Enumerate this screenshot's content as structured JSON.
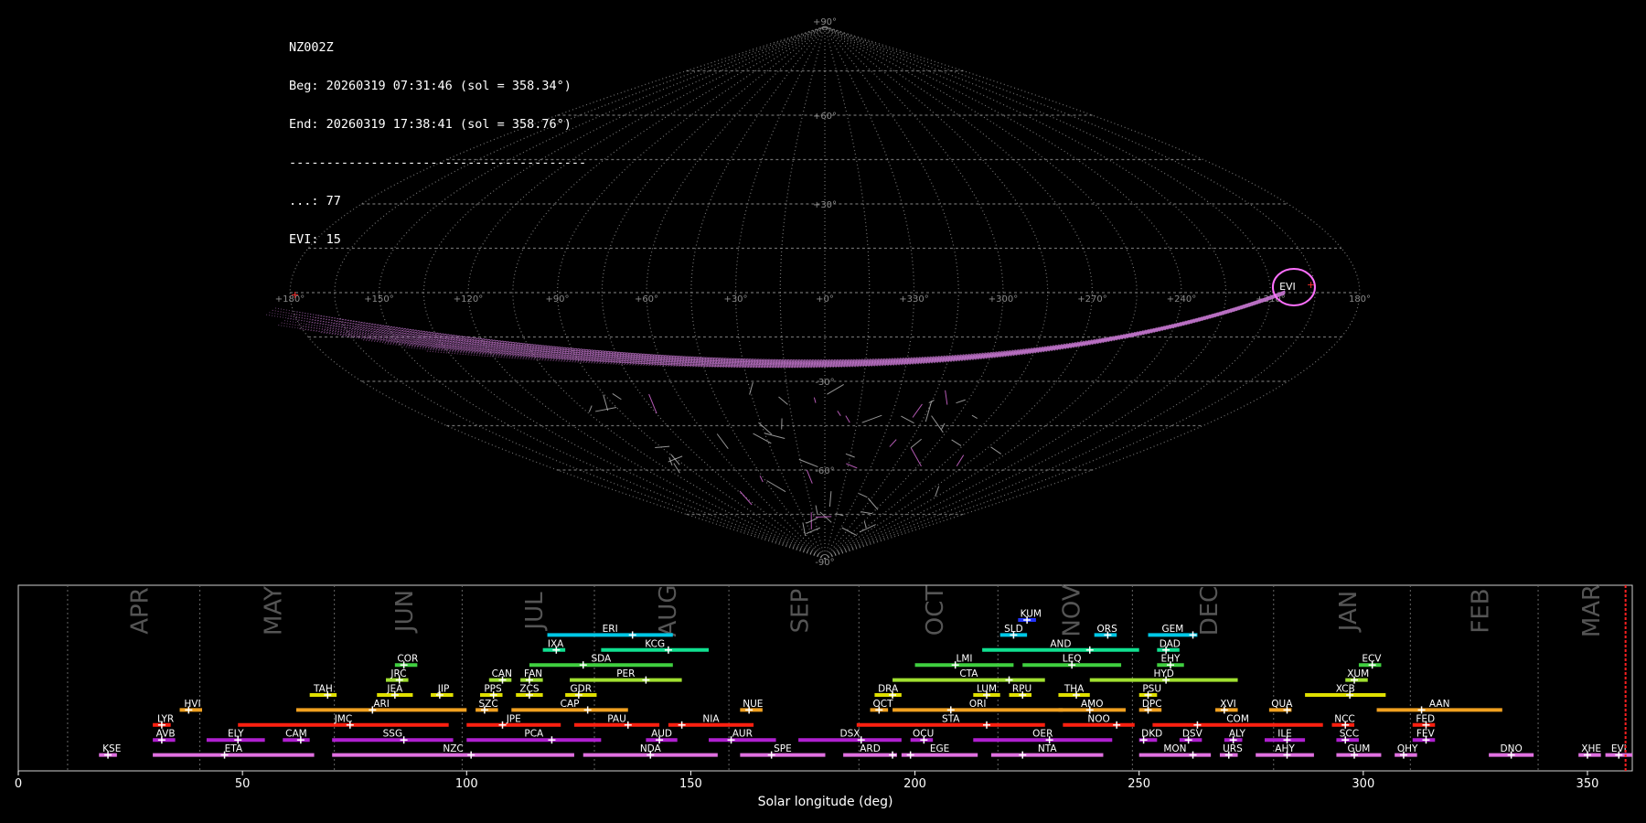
{
  "info": {
    "station": "NZ002Z",
    "begin": "Beg: 20260319 07:31:46 (sol = 358.34°)",
    "end": "End: 20260319 17:38:41 (sol = 358.76°)",
    "separator": "----------------------------------------",
    "sporadic": "...: 77",
    "shower": "EVI: 15"
  },
  "chart_data": [
    {
      "type": "scatter",
      "projection": "sinusoidal-equal-area",
      "lon_ticks": [
        "+180°",
        "+150°",
        "+120°",
        "+90°",
        "+60°",
        "+30°",
        "+0°",
        "+330°",
        "+300°",
        "+270°",
        "+240°",
        "+210°",
        "180°"
      ],
      "lat_ticks": [
        "+90°",
        "+60°",
        "+30°",
        "-30°",
        "-60°",
        "-90°"
      ],
      "radiant": {
        "label": "EVI",
        "ra": 185,
        "dec": 4
      }
    },
    {
      "type": "bar",
      "xlabel": "Solar longitude (deg)",
      "xlim": [
        0,
        360
      ],
      "xticks": [
        0,
        50,
        100,
        150,
        200,
        250,
        300,
        350
      ],
      "current_sol": 358.5,
      "months": [
        {
          "name": "APR",
          "start": 11
        },
        {
          "name": "MAY",
          "start": 40.5
        },
        {
          "name": "JUN",
          "start": 70.5
        },
        {
          "name": "JUL",
          "start": 99
        },
        {
          "name": "AUG",
          "start": 128.5
        },
        {
          "name": "SEP",
          "start": 158.5
        },
        {
          "name": "OCT",
          "start": 187.5
        },
        {
          "name": "NOV",
          "start": 218.5
        },
        {
          "name": "DEC",
          "start": 248.5
        },
        {
          "name": "JAN",
          "start": 280
        },
        {
          "name": "FEB",
          "start": 310.5
        },
        {
          "name": "MAR",
          "start": 339
        }
      ],
      "showers": [
        {
          "code": "KUM",
          "start": 223,
          "end": 227,
          "peak": 225,
          "row": 10,
          "color": "#2233ff"
        },
        {
          "code": "ERI",
          "start": 118,
          "end": 146,
          "peak": 137,
          "row": 9,
          "color": "#00c8e6"
        },
        {
          "code": "SLD",
          "start": 219,
          "end": 225,
          "peak": 222,
          "row": 9,
          "color": "#00c8e6"
        },
        {
          "code": "ORS",
          "start": 240,
          "end": 245,
          "peak": 243,
          "row": 9,
          "color": "#00c8e6"
        },
        {
          "code": "GEM",
          "start": 252,
          "end": 263,
          "peak": 262,
          "row": 9,
          "color": "#00c8e6"
        },
        {
          "code": "IXA",
          "start": 117,
          "end": 122,
          "peak": 120,
          "row": 8,
          "color": "#10e090"
        },
        {
          "code": "KCG",
          "start": 130,
          "end": 154,
          "peak": 145,
          "row": 8,
          "color": "#10e090"
        },
        {
          "code": "AND",
          "start": 215,
          "end": 250,
          "peak": 239,
          "row": 8,
          "color": "#10e090"
        },
        {
          "code": "DAD",
          "start": 254,
          "end": 259,
          "peak": 256,
          "row": 8,
          "color": "#10e090"
        },
        {
          "code": "COR",
          "start": 84,
          "end": 89,
          "peak": 86,
          "row": 7,
          "color": "#40d040"
        },
        {
          "code": "SDA",
          "start": 114,
          "end": 146,
          "peak": 126,
          "row": 7,
          "color": "#40d040"
        },
        {
          "code": "LMI",
          "start": 200,
          "end": 222,
          "peak": 209,
          "row": 7,
          "color": "#40d040"
        },
        {
          "code": "LEQ",
          "start": 224,
          "end": 246,
          "peak": 235,
          "row": 7,
          "color": "#40d040"
        },
        {
          "code": "EHY",
          "start": 254,
          "end": 260,
          "peak": 257,
          "row": 7,
          "color": "#40d040"
        },
        {
          "code": "ECV",
          "start": 299,
          "end": 304,
          "peak": 302,
          "row": 7,
          "color": "#40d040"
        },
        {
          "code": "JRC",
          "start": 82,
          "end": 87,
          "peak": 85,
          "row": 6,
          "color": "#a0e030"
        },
        {
          "code": "CAN",
          "start": 105,
          "end": 110,
          "peak": 108,
          "row": 6,
          "color": "#a0e030"
        },
        {
          "code": "FAN",
          "start": 112,
          "end": 117,
          "peak": 114,
          "row": 6,
          "color": "#a0e030"
        },
        {
          "code": "PER",
          "start": 123,
          "end": 148,
          "peak": 140,
          "row": 6,
          "color": "#a0e030"
        },
        {
          "code": "CTA",
          "start": 195,
          "end": 229,
          "peak": 221,
          "row": 6,
          "color": "#a0e030"
        },
        {
          "code": "HYD",
          "start": 239,
          "end": 272,
          "peak": 256,
          "row": 6,
          "color": "#a0e030"
        },
        {
          "code": "XUM",
          "start": 296,
          "end": 301,
          "peak": 298,
          "row": 6,
          "color": "#a0e030"
        },
        {
          "code": "TAH",
          "start": 65,
          "end": 71,
          "peak": 69,
          "row": 5,
          "color": "#e0e000"
        },
        {
          "code": "JEA",
          "start": 80,
          "end": 88,
          "peak": 84,
          "row": 5,
          "color": "#e0e000"
        },
        {
          "code": "JIP",
          "start": 92,
          "end": 97,
          "peak": 94,
          "row": 5,
          "color": "#e0e000"
        },
        {
          "code": "PPS",
          "start": 103,
          "end": 108,
          "peak": 106,
          "row": 5,
          "color": "#e0e000"
        },
        {
          "code": "ZCS",
          "start": 111,
          "end": 117,
          "peak": 114,
          "row": 5,
          "color": "#e0e000"
        },
        {
          "code": "GDR",
          "start": 122,
          "end": 129,
          "peak": 125,
          "row": 5,
          "color": "#e0e000"
        },
        {
          "code": "DRA",
          "start": 191,
          "end": 197,
          "peak": 195,
          "row": 5,
          "color": "#e0e000"
        },
        {
          "code": "LUM",
          "start": 213,
          "end": 219,
          "peak": 216,
          "row": 5,
          "color": "#e0e000"
        },
        {
          "code": "RPU",
          "start": 221,
          "end": 226,
          "peak": 224,
          "row": 5,
          "color": "#e0e000"
        },
        {
          "code": "THA",
          "start": 232,
          "end": 239,
          "peak": 236,
          "row": 5,
          "color": "#e0e000"
        },
        {
          "code": "PSU",
          "start": 250,
          "end": 254,
          "peak": 252,
          "row": 5,
          "color": "#e0e000"
        },
        {
          "code": "XCB",
          "start": 287,
          "end": 305,
          "peak": 297,
          "row": 5,
          "color": "#e0e000"
        },
        {
          "code": "HVI",
          "start": 36,
          "end": 41,
          "peak": 38,
          "row": 4,
          "color": "#f0a020"
        },
        {
          "code": "ARI",
          "start": 62,
          "end": 100,
          "peak": 79,
          "row": 4,
          "color": "#f0a020"
        },
        {
          "code": "SZC",
          "start": 102,
          "end": 107,
          "peak": 104,
          "row": 4,
          "color": "#f0a020"
        },
        {
          "code": "CAP",
          "start": 110,
          "end": 136,
          "peak": 127,
          "row": 4,
          "color": "#f0a020"
        },
        {
          "code": "NUE",
          "start": 161,
          "end": 166,
          "peak": 163,
          "row": 4,
          "color": "#f0a020"
        },
        {
          "code": "OCT",
          "start": 190,
          "end": 194,
          "peak": 192,
          "row": 4,
          "color": "#f0a020"
        },
        {
          "code": "ORI",
          "start": 195,
          "end": 233,
          "peak": 208,
          "row": 4,
          "color": "#f0a020"
        },
        {
          "code": "AMO",
          "start": 232,
          "end": 247,
          "peak": 239,
          "row": 4,
          "color": "#f0a020"
        },
        {
          "code": "DPC",
          "start": 250,
          "end": 255,
          "peak": 252,
          "row": 4,
          "color": "#f0a020"
        },
        {
          "code": "XVI",
          "start": 267,
          "end": 272,
          "peak": 269,
          "row": 4,
          "color": "#f0a020"
        },
        {
          "code": "QUA",
          "start": 279,
          "end": 284,
          "peak": 283,
          "row": 4,
          "color": "#f0a020"
        },
        {
          "code": "AAN",
          "start": 303,
          "end": 331,
          "peak": 313,
          "row": 4,
          "color": "#f0a020"
        },
        {
          "code": "LYR",
          "start": 30,
          "end": 34,
          "peak": 32,
          "row": 3,
          "color": "#ff2010"
        },
        {
          "code": "JMC",
          "start": 49,
          "end": 96,
          "peak": 74,
          "row": 3,
          "color": "#ff2010"
        },
        {
          "code": "JPE",
          "start": 100,
          "end": 121,
          "peak": 108,
          "row": 3,
          "color": "#ff2010"
        },
        {
          "code": "PAU",
          "start": 124,
          "end": 143,
          "peak": 136,
          "row": 3,
          "color": "#ff2010"
        },
        {
          "code": "NIA",
          "start": 145,
          "end": 164,
          "peak": 148,
          "row": 3,
          "color": "#ff2010"
        },
        {
          "code": "STA",
          "start": 187,
          "end": 229,
          "peak": 216,
          "row": 3,
          "color": "#ff2010"
        },
        {
          "code": "NOO",
          "start": 233,
          "end": 249,
          "peak": 245,
          "row": 3,
          "color": "#ff2010"
        },
        {
          "code": "COM",
          "start": 253,
          "end": 291,
          "peak": 263,
          "row": 3,
          "color": "#ff2010"
        },
        {
          "code": "NCC",
          "start": 293,
          "end": 298,
          "peak": 296,
          "row": 3,
          "color": "#ff2010"
        },
        {
          "code": "FED",
          "start": 311,
          "end": 316,
          "peak": 314,
          "row": 3,
          "color": "#ff2010"
        },
        {
          "code": "AVB",
          "start": 30,
          "end": 35,
          "peak": 32,
          "row": 2,
          "color": "#b020d0"
        },
        {
          "code": "ELY",
          "start": 42,
          "end": 55,
          "peak": 49,
          "row": 2,
          "color": "#b020d0"
        },
        {
          "code": "CAM",
          "start": 59,
          "end": 65,
          "peak": 63,
          "row": 2,
          "color": "#b020d0"
        },
        {
          "code": "SSG",
          "start": 70,
          "end": 97,
          "peak": 86,
          "row": 2,
          "color": "#b020d0"
        },
        {
          "code": "PCA",
          "start": 100,
          "end": 130,
          "peak": 119,
          "row": 2,
          "color": "#b020d0"
        },
        {
          "code": "AUD",
          "start": 140,
          "end": 147,
          "peak": 143,
          "row": 2,
          "color": "#b020d0"
        },
        {
          "code": "AUR",
          "start": 154,
          "end": 169,
          "peak": 159,
          "row": 2,
          "color": "#b020d0"
        },
        {
          "code": "DSX",
          "start": 174,
          "end": 197,
          "peak": 188,
          "row": 2,
          "color": "#b020d0"
        },
        {
          "code": "OCU",
          "start": 199,
          "end": 204,
          "peak": 202,
          "row": 2,
          "color": "#b020d0"
        },
        {
          "code": "OER",
          "start": 213,
          "end": 244,
          "peak": 230,
          "row": 2,
          "color": "#b020d0"
        },
        {
          "code": "DKD",
          "start": 250,
          "end": 254,
          "peak": 251,
          "row": 2,
          "color": "#b020d0"
        },
        {
          "code": "DSV",
          "start": 259,
          "end": 264,
          "peak": 261,
          "row": 2,
          "color": "#b020d0"
        },
        {
          "code": "ALY",
          "start": 269,
          "end": 273,
          "peak": 271,
          "row": 2,
          "color": "#b020d0"
        },
        {
          "code": "ILE",
          "start": 278,
          "end": 287,
          "peak": 283,
          "row": 2,
          "color": "#b020d0"
        },
        {
          "code": "SCC",
          "start": 294,
          "end": 299,
          "peak": 296,
          "row": 2,
          "color": "#b020d0"
        },
        {
          "code": "FEV",
          "start": 311,
          "end": 316,
          "peak": 314,
          "row": 2,
          "color": "#b020d0"
        },
        {
          "code": "KSE",
          "start": 18,
          "end": 22,
          "peak": 20,
          "row": 1,
          "color": "#e070e0"
        },
        {
          "code": "ETA",
          "start": 30,
          "end": 66,
          "peak": 46,
          "row": 1,
          "color": "#e070e0"
        },
        {
          "code": "NZC",
          "start": 70,
          "end": 124,
          "peak": 101,
          "row": 1,
          "color": "#e070e0"
        },
        {
          "code": "NDA",
          "start": 126,
          "end": 156,
          "peak": 141,
          "row": 1,
          "color": "#e070e0"
        },
        {
          "code": "SPE",
          "start": 161,
          "end": 180,
          "peak": 168,
          "row": 1,
          "color": "#e070e0"
        },
        {
          "code": "ARD",
          "start": 184,
          "end": 196,
          "peak": 195,
          "row": 1,
          "color": "#e070e0"
        },
        {
          "code": "EGE",
          "start": 197,
          "end": 214,
          "peak": 199,
          "row": 1,
          "color": "#e070e0"
        },
        {
          "code": "NTA",
          "start": 217,
          "end": 242,
          "peak": 224,
          "row": 1,
          "color": "#e070e0"
        },
        {
          "code": "MON",
          "start": 250,
          "end": 266,
          "peak": 262,
          "row": 1,
          "color": "#e070e0"
        },
        {
          "code": "URS",
          "start": 268,
          "end": 272,
          "peak": 270,
          "row": 1,
          "color": "#e070e0"
        },
        {
          "code": "AHY",
          "start": 276,
          "end": 289,
          "peak": 283,
          "row": 1,
          "color": "#e070e0"
        },
        {
          "code": "GUM",
          "start": 294,
          "end": 304,
          "peak": 298,
          "row": 1,
          "color": "#e070e0"
        },
        {
          "code": "OHY",
          "start": 307,
          "end": 312,
          "peak": 309,
          "row": 1,
          "color": "#e070e0"
        },
        {
          "code": "DNO",
          "start": 328,
          "end": 338,
          "peak": 333,
          "row": 1,
          "color": "#e070e0"
        },
        {
          "code": "XHE",
          "start": 348,
          "end": 353,
          "peak": 350,
          "row": 1,
          "color": "#e070e0"
        },
        {
          "code": "EVI",
          "start": 354,
          "end": 360,
          "peak": 357,
          "row": 1,
          "color": "#e070e0"
        }
      ]
    }
  ]
}
